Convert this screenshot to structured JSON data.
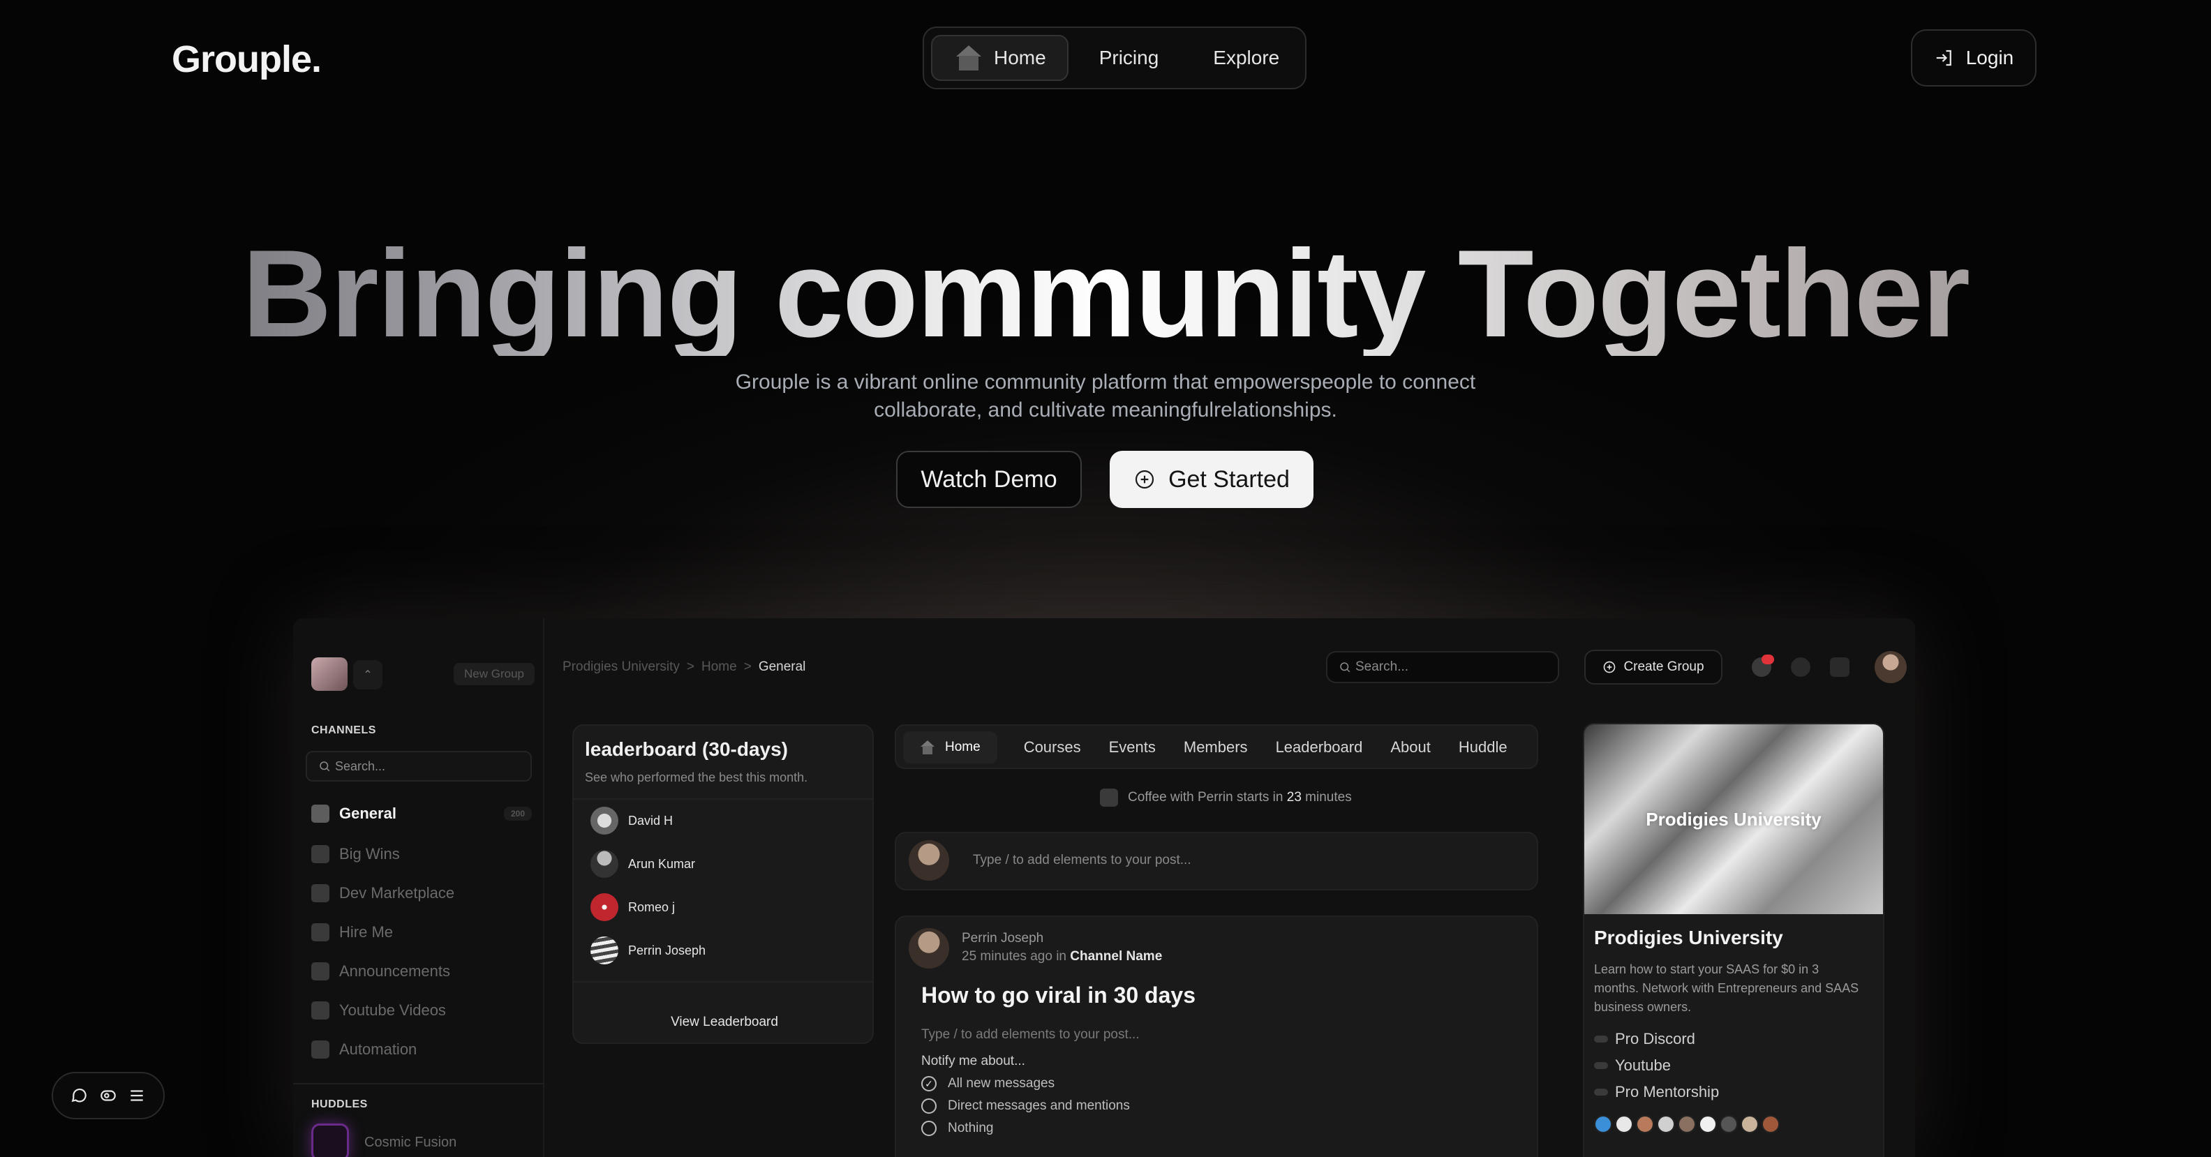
{
  "brand": {
    "logo": "Grouple."
  },
  "nav": {
    "items": [
      {
        "label": "Home",
        "icon": "house-icon",
        "active": true
      },
      {
        "label": "Pricing",
        "active": false
      },
      {
        "label": "Explore",
        "active": false
      }
    ],
    "login_label": "Login"
  },
  "hero": {
    "title": "Bringing community Together",
    "subtitle_line1": "Grouple is a vibrant online community platform that empowerspeople to connect",
    "subtitle_line2": "collaborate, and cultivate meaningfulrelationships.",
    "watch_demo_label": "Watch Demo",
    "get_started_label": "Get Started"
  },
  "app": {
    "sidebar": {
      "new_group_label": "New Group",
      "channels_heading": "CHANNELS",
      "search_placeholder": "Search...",
      "channels": [
        {
          "label": "General",
          "icon": "house-icon",
          "active": true,
          "badge": "200"
        },
        {
          "label": "Big Wins",
          "icon": "trophy-icon"
        },
        {
          "label": "Dev Marketplace",
          "icon": "store-icon"
        },
        {
          "label": "Hire Me",
          "icon": "document-icon"
        },
        {
          "label": "Announcements",
          "icon": "megaphone-icon"
        },
        {
          "label": "Youtube Videos",
          "icon": "video-icon"
        },
        {
          "label": "Automation",
          "icon": "bolt-icon"
        }
      ],
      "huddles_heading": "HUDDLES",
      "huddle_name": "Cosmic Fusion"
    },
    "topbar": {
      "breadcrumb": [
        "Prodigies University",
        "Home",
        "General"
      ],
      "breadcrumb_sep": ">",
      "search_placeholder": "Search...",
      "create_group_label": "Create Group"
    },
    "leaderboard": {
      "title": "leaderboard (30-days)",
      "subtitle": "See who performed the best this month.",
      "members": [
        "David H",
        "Arun Kumar",
        "Romeo j",
        "Perrin Joseph"
      ],
      "view_label": "View Leaderboard"
    },
    "tabs": [
      "Home",
      "Courses",
      "Events",
      "Members",
      "Leaderboard",
      "About",
      "Huddle"
    ],
    "coffee": {
      "prefix": "Coffee with Perrin starts in",
      "count": "23",
      "suffix": "minutes"
    },
    "composer_placeholder": "Type / to add elements to your post...",
    "post": {
      "author": "Perrin Joseph",
      "time": "25 minutes ago in",
      "channel": "Channel Name",
      "title": "How to go viral in 30 days",
      "hint": "Type / to add elements to your post...",
      "notify_label": "Notify me about...",
      "options": [
        {
          "label": "All new messages",
          "checked": true
        },
        {
          "label": "Direct messages and mentions",
          "checked": false
        },
        {
          "label": "Nothing",
          "checked": false
        }
      ]
    },
    "promo": {
      "image_logo": "Prodigies University",
      "title": "Prodigies University",
      "description": "Learn how to start your SAAS for $0 in 3 months. Network with Entrepreneurs and SAAS business owners.",
      "links": [
        "Pro Discord",
        "Youtube",
        "Pro Mentorship"
      ]
    }
  },
  "colors": {
    "background": "#050505",
    "accent_huddle": "#6a2a8a",
    "notification": "#e0333a"
  }
}
